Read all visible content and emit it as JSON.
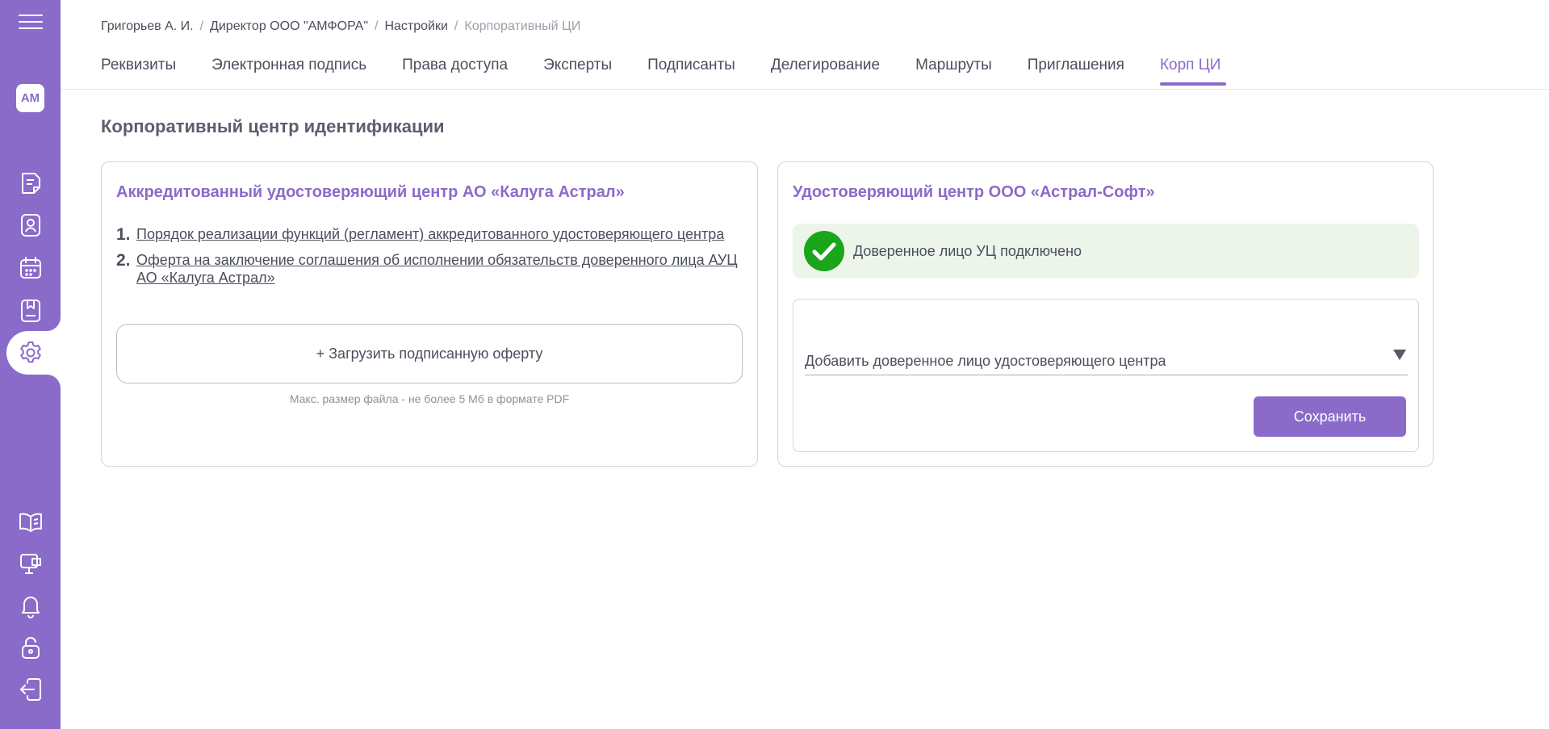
{
  "sidebar": {
    "menu_icon": "hamburger-menu-icon",
    "avatar_initials": "AM",
    "items": [
      {
        "name": "documents",
        "icon": "document-icon"
      },
      {
        "name": "contacts",
        "icon": "contact-card-icon"
      },
      {
        "name": "calendar",
        "icon": "calendar-icon"
      },
      {
        "name": "archive",
        "icon": "bookmark-book-icon"
      },
      {
        "name": "settings",
        "icon": "gear-icon",
        "active": true
      },
      {
        "name": "knowledge-base",
        "icon": "open-book-icon"
      },
      {
        "name": "support",
        "icon": "monitor-chat-icon"
      },
      {
        "name": "notifications",
        "icon": "bell-icon"
      },
      {
        "name": "lock",
        "icon": "lock-icon"
      },
      {
        "name": "logout",
        "icon": "logout-icon"
      }
    ]
  },
  "breadcrumb": {
    "items": [
      "Григорьев А. И.",
      "Директор ООО \"АМФОРА\"",
      "Настройки"
    ],
    "current": "Корпоративный ЦИ",
    "separator": "/"
  },
  "tabs": [
    {
      "label": "Реквизиты"
    },
    {
      "label": "Электронная подпись"
    },
    {
      "label": "Права доступа"
    },
    {
      "label": "Эксперты"
    },
    {
      "label": "Подписанты"
    },
    {
      "label": "Делегирование"
    },
    {
      "label": "Маршруты"
    },
    {
      "label": "Приглашения"
    },
    {
      "label": "Корп ЦИ",
      "active": true
    }
  ],
  "page_title": "Корпоративный центр идентификации",
  "left_card": {
    "title": "Аккредитованный удостоверяющий центр АО «Калуга Астрал»",
    "documents": [
      {
        "num": "1.",
        "label": "Порядок реализации функций (регламент) аккредитованного удостоверяющего центра"
      },
      {
        "num": "2.",
        "label": "Оферта на заключение соглашения об исполнении обязательств доверенного лица АУЦ АО «Калуга Астрал»"
      }
    ],
    "upload_label": "+ Загрузить подписанную оферту",
    "upload_hint": "Макс. размер файла - не более 5 Мб в формате PDF"
  },
  "right_card": {
    "title": "Удостоверяющий центр ООО «Астрал-Софт»",
    "status_text": "Доверенное лицо УЦ подключено",
    "select_value": "Добавить доверенное лицо удостоверяющего центра",
    "save_label": "Сохранить"
  },
  "colors": {
    "accent": "#8a6bc9",
    "success": "#1aa51a",
    "success_bg": "#edf5ea"
  }
}
